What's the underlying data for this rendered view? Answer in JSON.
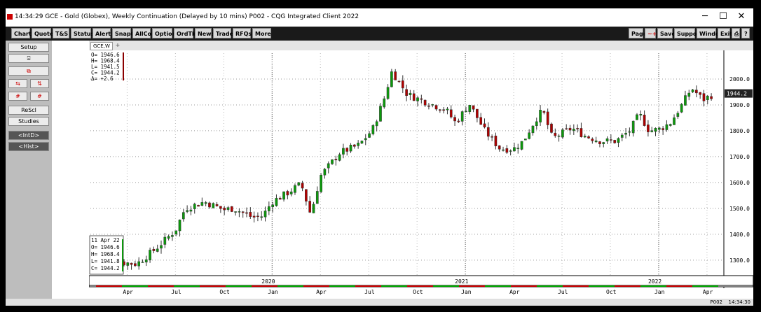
{
  "window": {
    "title": "14:34:29 GCE - Gold (Globex), Weekly Continuation (Delayed by 10 mins) P002 - CQG Integrated Client 2022",
    "minimize": "─",
    "maximize": "☐",
    "close": "✕"
  },
  "toolbar": {
    "left": [
      "Chart",
      "Quote",
      "T&S",
      "Status",
      "Alert",
      "SnapQ",
      "AllCon",
      "Options",
      "OrdTkt",
      "News",
      "Trade",
      "RFQs",
      "More"
    ],
    "right": [
      "Page",
      "~+",
      "Save",
      "Support",
      "Window",
      "Exit",
      "⎙",
      "?"
    ]
  },
  "sidebar": {
    "setup": "Setup",
    "row2": "⍃",
    "row3": "⧉",
    "row4a": "⇆",
    "row4b": "⇅",
    "row5a": "#",
    "row5b": "#",
    "rescl": "ReScl",
    "studies": "Studies",
    "intd": "<IntD>",
    "hist": "<Hist>"
  },
  "chart_tab": {
    "label": "GCE,W",
    "add": "+"
  },
  "ohlc_top": [
    "O= 1946.6",
    "H= 1968.4",
    "L= 1941.5",
    "C= 1944.2",
    "Δ=  +2.6"
  ],
  "ohlc_bottom": [
    "11 Apr 22",
    "O= 1946.6",
    "H= 1968.4",
    "L= 1941.8",
    "C= 1944.2"
  ],
  "chart_data": {
    "type": "candlestick",
    "instrument": "GCE",
    "timeframe": "Weekly",
    "y_ticks": [
      "2000.0",
      "1900.0",
      "1800.0",
      "1700.0",
      "1600.0",
      "1500.0",
      "1400.0",
      "1300.0"
    ],
    "y_tick_values": [
      2000,
      1900,
      1800,
      1700,
      1600,
      1500,
      1400,
      1300
    ],
    "ylim": [
      1240,
      2100
    ],
    "last_price_label": "1944.2",
    "last_price": 1944.2,
    "year_labels": [
      "2020",
      "2021",
      "2022"
    ],
    "year_positions": [
      2020.0,
      2021.0,
      2022.0
    ],
    "month_labels": [
      "Apr",
      "Jul",
      "Oct",
      "Jan",
      "Apr",
      "Jul",
      "Oct",
      "Jan",
      "Apr",
      "Jul",
      "Oct",
      "Jan",
      "Apr"
    ],
    "month_positions": [
      2019.25,
      2019.5,
      2019.75,
      2020.0,
      2020.25,
      2020.5,
      2020.75,
      2021.0,
      2021.25,
      2021.5,
      2021.75,
      2022.0,
      2022.25
    ],
    "xlim": [
      2019.06,
      2022.33
    ],
    "close_anchors": [
      [
        2019.08,
        1300
      ],
      [
        2019.17,
        1295
      ],
      [
        2019.3,
        1285
      ],
      [
        2019.4,
        1345
      ],
      [
        2019.5,
        1415
      ],
      [
        2019.55,
        1500
      ],
      [
        2019.65,
        1525
      ],
      [
        2019.75,
        1495
      ],
      [
        2019.8,
        1500
      ],
      [
        2019.9,
        1465
      ],
      [
        2019.95,
        1470
      ],
      [
        2020.0,
        1525
      ],
      [
        2020.08,
        1560
      ],
      [
        2020.15,
        1595
      ],
      [
        2020.2,
        1475
      ],
      [
        2020.25,
        1625
      ],
      [
        2020.35,
        1715
      ],
      [
        2020.45,
        1745
      ],
      [
        2020.52,
        1805
      ],
      [
        2020.58,
        1925
      ],
      [
        2020.62,
        2030
      ],
      [
        2020.7,
        1940
      ],
      [
        2020.8,
        1910
      ],
      [
        2020.9,
        1880
      ],
      [
        2020.95,
        1830
      ],
      [
        2021.02,
        1905
      ],
      [
        2021.1,
        1800
      ],
      [
        2021.18,
        1730
      ],
      [
        2021.25,
        1730
      ],
      [
        2021.3,
        1760
      ],
      [
        2021.36,
        1840
      ],
      [
        2021.4,
        1880
      ],
      [
        2021.45,
        1770
      ],
      [
        2021.55,
        1810
      ],
      [
        2021.62,
        1780
      ],
      [
        2021.7,
        1760
      ],
      [
        2021.78,
        1760
      ],
      [
        2021.85,
        1800
      ],
      [
        2021.9,
        1865
      ],
      [
        2021.95,
        1800
      ],
      [
        2022.0,
        1805
      ],
      [
        2022.06,
        1830
      ],
      [
        2022.12,
        1900
      ],
      [
        2022.17,
        1965
      ],
      [
        2022.23,
        1920
      ],
      [
        2022.29,
        1944
      ]
    ]
  },
  "statusbar": {
    "account": "P002",
    "time": "14:34:30"
  }
}
